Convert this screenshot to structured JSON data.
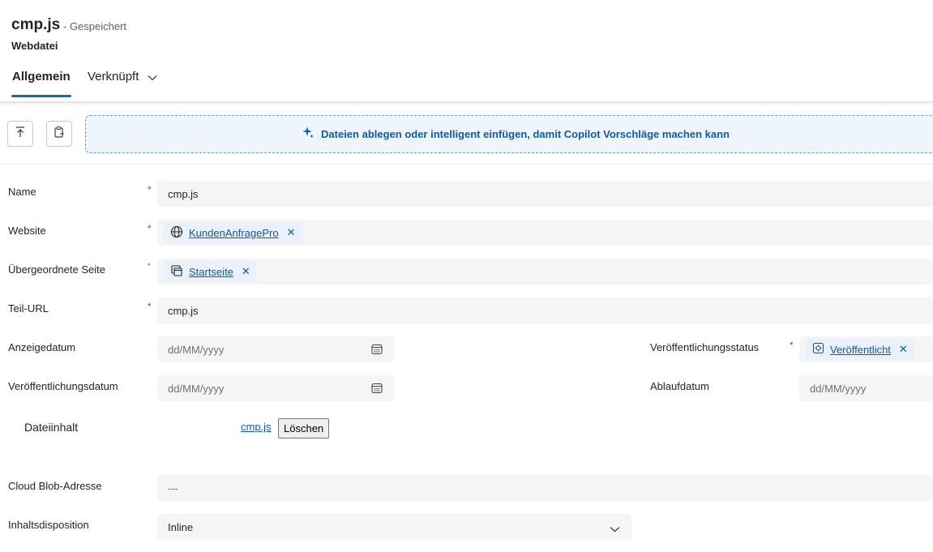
{
  "header": {
    "title": "cmp.js",
    "save_status": "- Gespeichert",
    "entity": "Webdatei",
    "tabs": [
      {
        "label": "Allgemein",
        "active": true
      },
      {
        "label": "Verknüpft",
        "active": false
      }
    ]
  },
  "toolbar": {
    "upload_icon": "upload-icon",
    "paste_icon": "paste-icon",
    "dropzone_text": "Dateien ablegen oder intelligent einfügen, damit Copilot Vorschläge machen kann",
    "dropzone_icon": "copilot-sparkle-icon"
  },
  "form": {
    "name": {
      "label": "Name",
      "required": "*",
      "value": "cmp.js"
    },
    "website": {
      "label": "Website",
      "required": "*",
      "value": "KundenAnfragePro",
      "remove": "✕"
    },
    "parent_page": {
      "label": "Übergeordnete Seite",
      "required": "*",
      "value": "Startseite",
      "remove": "✕"
    },
    "partial_url": {
      "label": "Teil-URL",
      "required": "*",
      "value": "cmp.js"
    },
    "display_date": {
      "label": "Anzeigedatum",
      "placeholder": "dd/MM/yyyy"
    },
    "publish_status": {
      "label": "Veröffentlichungsstatus",
      "required": "*",
      "value": "Veröffentlicht",
      "remove": "✕"
    },
    "publish_date": {
      "label": "Veröffentlichungsdatum",
      "placeholder": "dd/MM/yyyy"
    },
    "expiry_date": {
      "label": "Ablaufdatum",
      "placeholder": "dd/MM/yyyy"
    },
    "file_content": {
      "label": "Dateiinhalt",
      "file": "cmp.js",
      "delete_label": "Löschen"
    },
    "blob_address": {
      "label": "Cloud Blob-Adresse",
      "value": "---"
    },
    "disposition": {
      "label": "Inhaltsdisposition",
      "value": "Inline"
    }
  },
  "colors": {
    "accent": "#0f6cbd",
    "required": "#c4314b",
    "link": "#0f5aa8"
  }
}
